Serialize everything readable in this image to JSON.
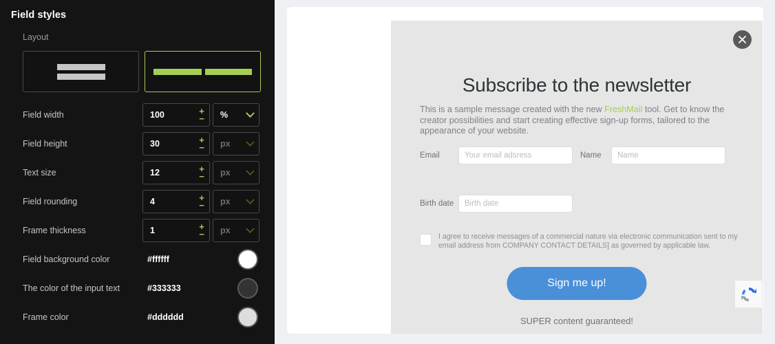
{
  "sidebar": {
    "title": "Field styles",
    "layout": {
      "label": "Layout",
      "options": [
        {
          "name": "stacked",
          "selected": false
        },
        {
          "name": "inline",
          "selected": true
        }
      ]
    },
    "rows": [
      {
        "label": "Field width",
        "value": "100",
        "unit": "%",
        "unit_active": true,
        "plus": "+",
        "minus": "−"
      },
      {
        "label": "Field height",
        "value": "30",
        "unit": "px",
        "unit_active": false,
        "plus": "+",
        "minus": "−"
      },
      {
        "label": "Text size",
        "value": "12",
        "unit": "px",
        "unit_active": false,
        "plus": "+",
        "minus": "−"
      },
      {
        "label": "Field rounding",
        "value": "4",
        "unit": "px",
        "unit_active": false,
        "plus": "+",
        "minus": "−"
      },
      {
        "label": "Frame thickness",
        "value": "1",
        "unit": "px",
        "unit_active": false,
        "plus": "+",
        "minus": "−"
      }
    ],
    "colors": [
      {
        "label": "Field background color",
        "value": "#ffffff",
        "swatch": "#ffffff"
      },
      {
        "label": "The color of the input text",
        "value": "#333333",
        "swatch": "#333333"
      },
      {
        "label": "Frame color",
        "value": "#dddddd",
        "swatch": "#dddddd"
      }
    ],
    "accent": "#a6ce55",
    "background": "#141414"
  },
  "modal": {
    "close_label": "close",
    "title": "Subscribe to the newsletter",
    "description_part1": "This is a sample message created with the new ",
    "brand": "FreshMail",
    "description_part2": " tool. Get to know the creator possibilities and start creating effective sign-up forms, tailored to the appearance of your website.",
    "fields": [
      {
        "label": "Email",
        "placeholder": "Your email adsress"
      },
      {
        "label": "Name",
        "placeholder": "Name"
      },
      {
        "label": "Birth date",
        "placeholder": "Birth date"
      }
    ],
    "consent": "I agree to receive messages of a commercial nature via electronic communication sent to my email address from COMPANY CONTACT DETAILS] as governed by applicable law.",
    "submit_label": "Sign me up!",
    "footer_note": "SUPER content guaranteed!",
    "recaptcha_label": "recaptcha-badge",
    "button_color": "#4a90d9",
    "background": "#e6e6e6"
  }
}
